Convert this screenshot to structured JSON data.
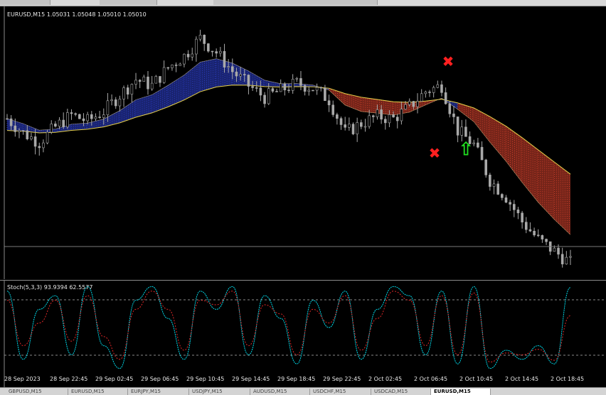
{
  "window": {
    "main_chart_title": "EURUSD,M15  1.05031 1.05048 1.05010 1.05010",
    "stoch_title": "Stoch(5,3,3) 93.9394 62.5577"
  },
  "time_axis": [
    "28 Sep 2023",
    "28 Sep 22:45",
    "29 Sep 02:45",
    "29 Sep 06:45",
    "29 Sep 10:45",
    "29 Sep 14:45",
    "29 Sep 18:45",
    "29 Sep 22:45",
    "2 Oct 02:45",
    "2 Oct 06:45",
    "2 Oct 10:45",
    "2 Oct 14:45",
    "2 Oct 18:45"
  ],
  "tabs": [
    {
      "label": "GBPUSD,M15",
      "active": false
    },
    {
      "label": "EURUSD,M15",
      "active": false
    },
    {
      "label": "EURJPY,M15",
      "active": false
    },
    {
      "label": "USDJPY,M15",
      "active": false
    },
    {
      "label": "AUDUSD,M15",
      "active": false
    },
    {
      "label": "USDCHF,M15",
      "active": false
    },
    {
      "label": "USDCAD,M15",
      "active": false
    },
    {
      "label": "EURUSD,M15",
      "active": true
    }
  ],
  "signals": [
    {
      "type": "sell-cross",
      "label": "✖"
    },
    {
      "type": "sell-cross",
      "label": "✖"
    },
    {
      "type": "buy-arrow",
      "label": "⇧"
    }
  ],
  "colors": {
    "background": "#000000",
    "candle": "#a9a9a9",
    "cloud_bull": "#2e3fc9",
    "cloud_bear": "#d2412d",
    "ma_line": "#e8d24a",
    "stoch_main": "#00d8e8",
    "stoch_signal": "#e02828",
    "sell_signal": "#ff2020",
    "buy_signal": "#20e020"
  },
  "stoch_levels": {
    "upper": 80,
    "lower": 20
  },
  "chart_data": [
    {
      "type": "line",
      "title": "EURUSD,M15  1.05031 1.05048 1.05010 1.05010",
      "series": [
        {
          "name": "",
          "values": [
            1.0572,
            1.056,
            1.0552,
            1.0565,
            1.0575,
            1.057,
            1.0578,
            1.0592,
            1.0605,
            1.06,
            1.0615,
            1.0625,
            1.064,
            1.0628,
            1.0612,
            1.06,
            1.059,
            1.0596,
            1.0602,
            1.0598,
            1.0588,
            1.056,
            1.0568,
            1.0574,
            1.0572,
            1.0582,
            1.0595,
            1.06,
            1.0562,
            1.055,
            1.052,
            1.0506,
            1.0485,
            1.047,
            1.046,
            1.045
          ]
        }
      ]
    },
    {
      "type": "line",
      "title": "Stoch(5,3,3) 93.9394 62.5577",
      "ylim": [
        0,
        100
      ],
      "series": [
        {
          "name": "",
          "values": [
            90,
            15,
            70,
            85,
            20,
            95,
            30,
            5,
            80,
            95,
            60,
            15,
            90,
            70,
            95,
            20,
            85,
            60,
            10,
            80,
            50,
            90,
            15,
            70,
            95,
            85,
            20,
            90,
            10,
            95,
            5,
            25,
            15,
            30,
            10,
            94
          ]
        },
        {
          "name": "",
          "values": [
            80,
            30,
            55,
            80,
            35,
            85,
            40,
            15,
            70,
            90,
            70,
            25,
            80,
            75,
            90,
            30,
            75,
            65,
            20,
            70,
            55,
            85,
            25,
            60,
            90,
            80,
            30,
            85,
            20,
            88,
            12,
            22,
            20,
            26,
            14,
            63
          ]
        }
      ]
    }
  ]
}
